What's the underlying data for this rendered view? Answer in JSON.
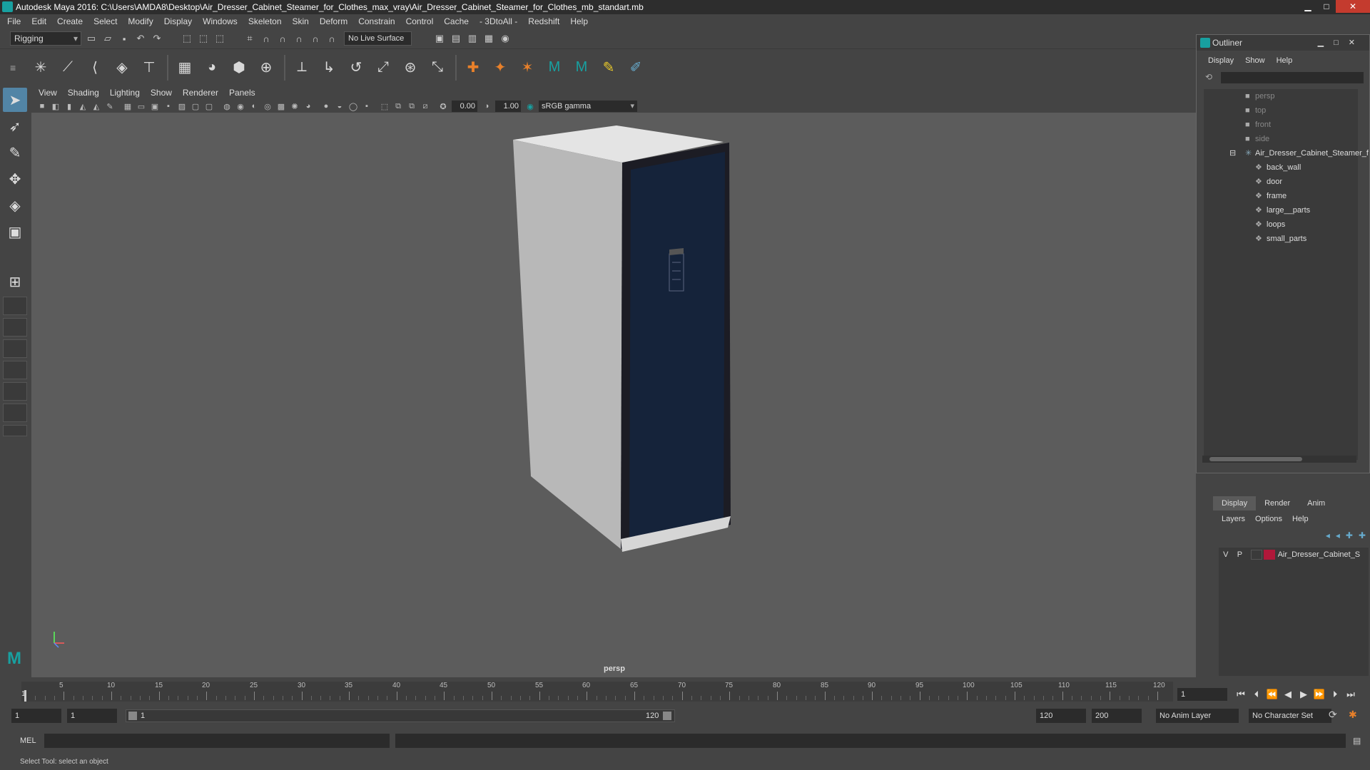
{
  "app": {
    "title": "Autodesk Maya 2016: C:\\Users\\AMDA8\\Desktop\\Air_Dresser_Cabinet_Steamer_for_Clothes_max_vray\\Air_Dresser_Cabinet_Steamer_for_Clothes_mb_standart.mb"
  },
  "menubar": [
    "File",
    "Edit",
    "Create",
    "Select",
    "Modify",
    "Display",
    "Windows",
    "Skeleton",
    "Skin",
    "Deform",
    "Constrain",
    "Control",
    "Cache",
    "- 3DtoAll -",
    "Redshift",
    "Help"
  ],
  "toolbar": {
    "mode": "Rigging",
    "live_surface": "No Live Surface"
  },
  "viewport": {
    "menu": [
      "View",
      "Shading",
      "Lighting",
      "Show",
      "Renderer",
      "Panels"
    ],
    "exposure": "0.00",
    "gamma": "1.00",
    "colorspace": "sRGB gamma",
    "camera_label": "persp"
  },
  "outliner": {
    "title": "Outliner",
    "menu": [
      "Display",
      "Show",
      "Help"
    ],
    "cameras": [
      "persp",
      "top",
      "front",
      "side"
    ],
    "group": "Air_Dresser_Cabinet_Steamer_f",
    "children": [
      "back_wall",
      "door",
      "frame",
      "large__parts",
      "loops",
      "small_parts"
    ]
  },
  "layers": {
    "tabs": [
      "Display",
      "Render",
      "Anim"
    ],
    "active_tab": "Display",
    "menu": [
      "Layers",
      "Options",
      "Help"
    ],
    "rows": [
      {
        "v": "V",
        "p": "P",
        "name": "Air_Dresser_Cabinet_S",
        "color": "#b0183a"
      }
    ]
  },
  "timeline": {
    "ticks": [
      "5",
      "10",
      "15",
      "20",
      "25",
      "30",
      "35",
      "40",
      "45",
      "50",
      "55",
      "60",
      "65",
      "70",
      "75",
      "80",
      "85",
      "90",
      "95",
      "100",
      "105",
      "110",
      "115",
      "120"
    ],
    "start_marker": "1",
    "current_frame": "1"
  },
  "range": {
    "start": "1",
    "playback_start": "1",
    "slider_start": "1",
    "slider_end": "120",
    "playback_end": "120",
    "end": "200",
    "anim_layer": "No Anim Layer",
    "character_set": "No Character Set"
  },
  "command": {
    "label": "MEL"
  },
  "status": {
    "text": "Select Tool: select an object"
  }
}
